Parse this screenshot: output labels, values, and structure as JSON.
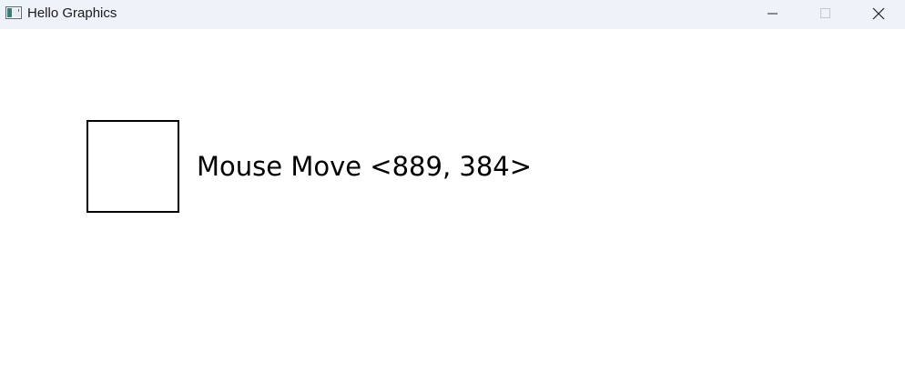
{
  "window": {
    "title": "Hello Graphics",
    "app_icon": "window-app-icon",
    "controls": {
      "minimize_icon": "minimize-icon",
      "maximize_icon": "maximize-icon",
      "close_icon": "close-icon"
    }
  },
  "canvas": {
    "shape": "square-outline",
    "mouse_text": "Mouse Move <889, 384>"
  },
  "colors": {
    "titlebar_bg": "#eef2f9",
    "canvas_bg": "#ffffff",
    "stroke": "#000000"
  }
}
